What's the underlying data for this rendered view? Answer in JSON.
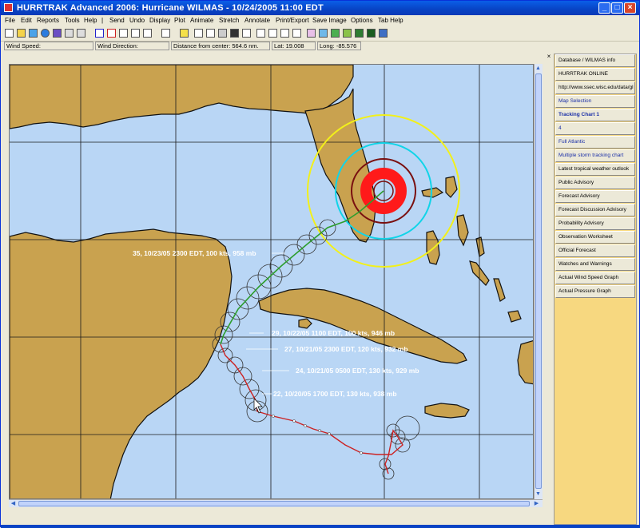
{
  "window": {
    "title": "HURRTRAK Advanced 2006: Hurricane WILMAS - 10/24/2005 11:00 EDT"
  },
  "menu": [
    "File",
    "Edit",
    "Reports",
    "Tools",
    "Help",
    "|",
    "Send",
    "Undo",
    "Display",
    "Plot",
    "Animate",
    "Stretch",
    "Annotate",
    "Print/Export",
    "Save Image",
    "Options",
    "Tab Help"
  ],
  "status": {
    "wind_speed": "Wind Speed:",
    "wind_direction": "Wind Direction:",
    "distance": "Distance from center: 564.6 nm.",
    "lat": "Lat: 19.008",
    "long": "Long: -85.576"
  },
  "map": {
    "labels": [
      {
        "id": "label-35",
        "text": "35, 10/23/05 2300 EDT, 100  kts, 958 mb"
      },
      {
        "id": "label-29",
        "text": "29, 10/22/05 1100 EDT, 100  kts, 946 mb"
      },
      {
        "id": "label-27",
        "text": "27, 10/21/05 2300 EDT, 120  kts, 932 mb"
      },
      {
        "id": "label-24",
        "text": "24, 10/21/05 0500 EDT, 130  kts, 929 mb"
      },
      {
        "id": "label-22",
        "text": "22, 10/20/05 1700 EDT, 130  kts, 938 mb"
      }
    ],
    "colors": {
      "ocean": "#b9d6f5",
      "land": "#c9a24f",
      "grid": "#1a1a1a",
      "track_green": "#2e9e2e",
      "track_red": "#cc2222",
      "wind_red": "#ff1a1a",
      "cyan": "#11d4e8",
      "yellow": "#f2f01a",
      "darkred": "#7a1010"
    }
  },
  "panel": {
    "close": "×",
    "buttons": [
      {
        "label": "Database / WILMAS info",
        "style": ""
      },
      {
        "label": "HURRTRAK ONLINE",
        "style": ""
      },
      {
        "label": "http://www.ssec.wisc.edu/data/gl",
        "style": ""
      },
      {
        "label": "Map Selection",
        "style": "blue"
      },
      {
        "label": "Tracking Chart 1",
        "style": "bold"
      },
      {
        "label": "4",
        "style": "blue"
      },
      {
        "label": "Full Atlantic",
        "style": "blue"
      },
      {
        "label": "Multiple storm tracking chart",
        "style": "blue"
      },
      {
        "label": "Latest tropical weather outlook",
        "style": ""
      },
      {
        "label": "Public Advisory",
        "style": ""
      },
      {
        "label": "Forecast Advisory",
        "style": ""
      },
      {
        "label": "Forecast Discussion Advisory",
        "style": ""
      },
      {
        "label": "Probability Advisory",
        "style": ""
      },
      {
        "label": "Observation Worksheet",
        "style": ""
      },
      {
        "label": "Official Forecast",
        "style": ""
      },
      {
        "label": "Watches and Warnings",
        "style": ""
      },
      {
        "label": "Actual Wind Speed Graph",
        "style": ""
      },
      {
        "label": "Actual Pressure Graph",
        "style": ""
      }
    ]
  }
}
